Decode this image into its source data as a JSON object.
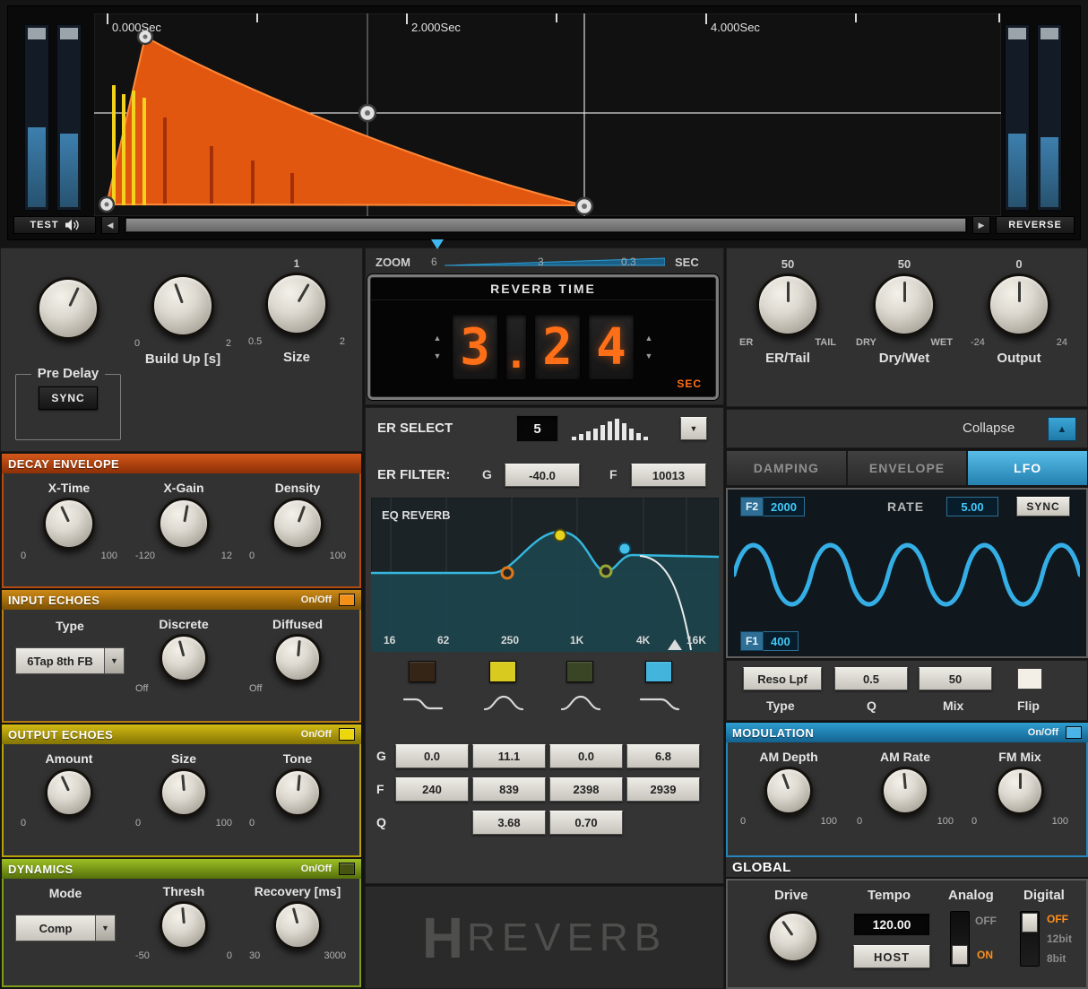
{
  "top": {
    "time_labels": [
      "0.000Sec",
      "2.000Sec",
      "4.000Sec"
    ],
    "test": "TEST",
    "reverse": "REVERSE"
  },
  "zoom": {
    "label": "ZOOM",
    "max": "6",
    "mid": "3",
    "min": "0.3",
    "unit": "SEC"
  },
  "reverb_time": {
    "title": "REVERB TIME",
    "d1": "3",
    "dot": ".",
    "d2": "2",
    "d3": "4",
    "unit": "SEC"
  },
  "er_select": {
    "label": "ER SELECT",
    "value": "5"
  },
  "er_filter": {
    "label": "ER FILTER:",
    "g": "G",
    "g_value": "-40.0",
    "f": "F",
    "f_value": "10013"
  },
  "eq": {
    "title": "EQ REVERB",
    "freqs": [
      "16",
      "62",
      "250",
      "1K",
      "4K",
      "16K"
    ],
    "g_label": "G",
    "f_label": "F",
    "q_label": "Q",
    "g_values": [
      "0.0",
      "11.1",
      "0.0",
      "6.8"
    ],
    "f_values": [
      "240",
      "839",
      "2398",
      "2939"
    ],
    "q_values": [
      "3.68",
      "0.70"
    ]
  },
  "logo": {
    "h": "H",
    "rest": "REVERB"
  },
  "predelay": {
    "label": "Pre Delay",
    "sync": "SYNC"
  },
  "buildup": {
    "label": "Build Up [s]",
    "min": "0",
    "max": "2"
  },
  "size": {
    "label": "Size",
    "min": "0.5",
    "max": "2",
    "mid": "1"
  },
  "decay": {
    "title": "DECAY ENVELOPE",
    "k1": {
      "label": "X-Time",
      "min": "0",
      "max": "100"
    },
    "k2": {
      "label": "X-Gain",
      "min": "-120",
      "max": "12"
    },
    "k3": {
      "label": "Density",
      "min": "0",
      "max": "100"
    }
  },
  "input_echoes": {
    "title": "INPUT ECHOES",
    "onoff": "On/Off",
    "type_label": "Type",
    "type_value": "6Tap 8th FB",
    "k1": {
      "label": "Discrete",
      "min": "Off"
    },
    "k2": {
      "label": "Diffused",
      "min": "Off"
    }
  },
  "output_echoes": {
    "title": "OUTPUT ECHOES",
    "onoff": "On/Off",
    "k1": {
      "label": "Amount",
      "min": "0"
    },
    "k2": {
      "label": "Size",
      "min": "0",
      "max": "100"
    },
    "k3": {
      "label": "Tone",
      "min": "0"
    }
  },
  "dynamics": {
    "title": "DYNAMICS",
    "onoff": "On/Off",
    "mode_label": "Mode",
    "mode_value": "Comp",
    "k1": {
      "label": "Thresh",
      "min": "-50",
      "max": "0"
    },
    "k2": {
      "label": "Recovery [ms]",
      "min": "30",
      "max": "3000"
    }
  },
  "er_tail": {
    "value": "50",
    "min": "ER",
    "max": "TAIL",
    "label": "ER/Tail"
  },
  "dry_wet": {
    "value": "50",
    "min": "DRY",
    "max": "WET",
    "label": "Dry/Wet"
  },
  "output": {
    "value": "0",
    "min": "-24",
    "max": "24",
    "label": "Output"
  },
  "collapse": {
    "label": "Collapse"
  },
  "tabs": [
    "DAMPING",
    "ENVELOPE",
    "LFO"
  ],
  "lfo": {
    "f2": "F2",
    "f2_value": "2000",
    "rate_label": "RATE",
    "rate_value": "5.00",
    "sync": "SYNC",
    "f1": "F1",
    "f1_value": "400"
  },
  "post_filter": {
    "type_value": "Reso Lpf",
    "q_value": "0.5",
    "mix_value": "50",
    "type_label": "Type",
    "q_label": "Q",
    "mix_label": "Mix",
    "flip_label": "Flip"
  },
  "modulation": {
    "title": "MODULATION",
    "onoff": "On/Off",
    "k1": {
      "label": "AM Depth",
      "min": "0",
      "max": "100"
    },
    "k2": {
      "label": "AM Rate",
      "min": "0",
      "max": "100"
    },
    "k3": {
      "label": "FM Mix",
      "min": "0",
      "max": "100"
    }
  },
  "global": {
    "title": "GLOBAL",
    "drive": "Drive",
    "tempo": "Tempo",
    "tempo_value": "120.00",
    "host": "HOST",
    "analog": "Analog",
    "analog_off": "OFF",
    "analog_on": "ON",
    "digital": "Digital",
    "digital_off": "OFF",
    "digital_12": "12bit",
    "digital_8": "8bit"
  },
  "colors": {
    "accent_blue": "#2f9fd6",
    "lcd_orange": "#ff6f18",
    "envelope_orange": "#e2570f",
    "decay_header": "#c24c12",
    "input_header": "#c07f10",
    "output_header": "#c4ac0c",
    "dynamics_header": "#7f9e1e",
    "modulation_header": "#1f85b8"
  }
}
